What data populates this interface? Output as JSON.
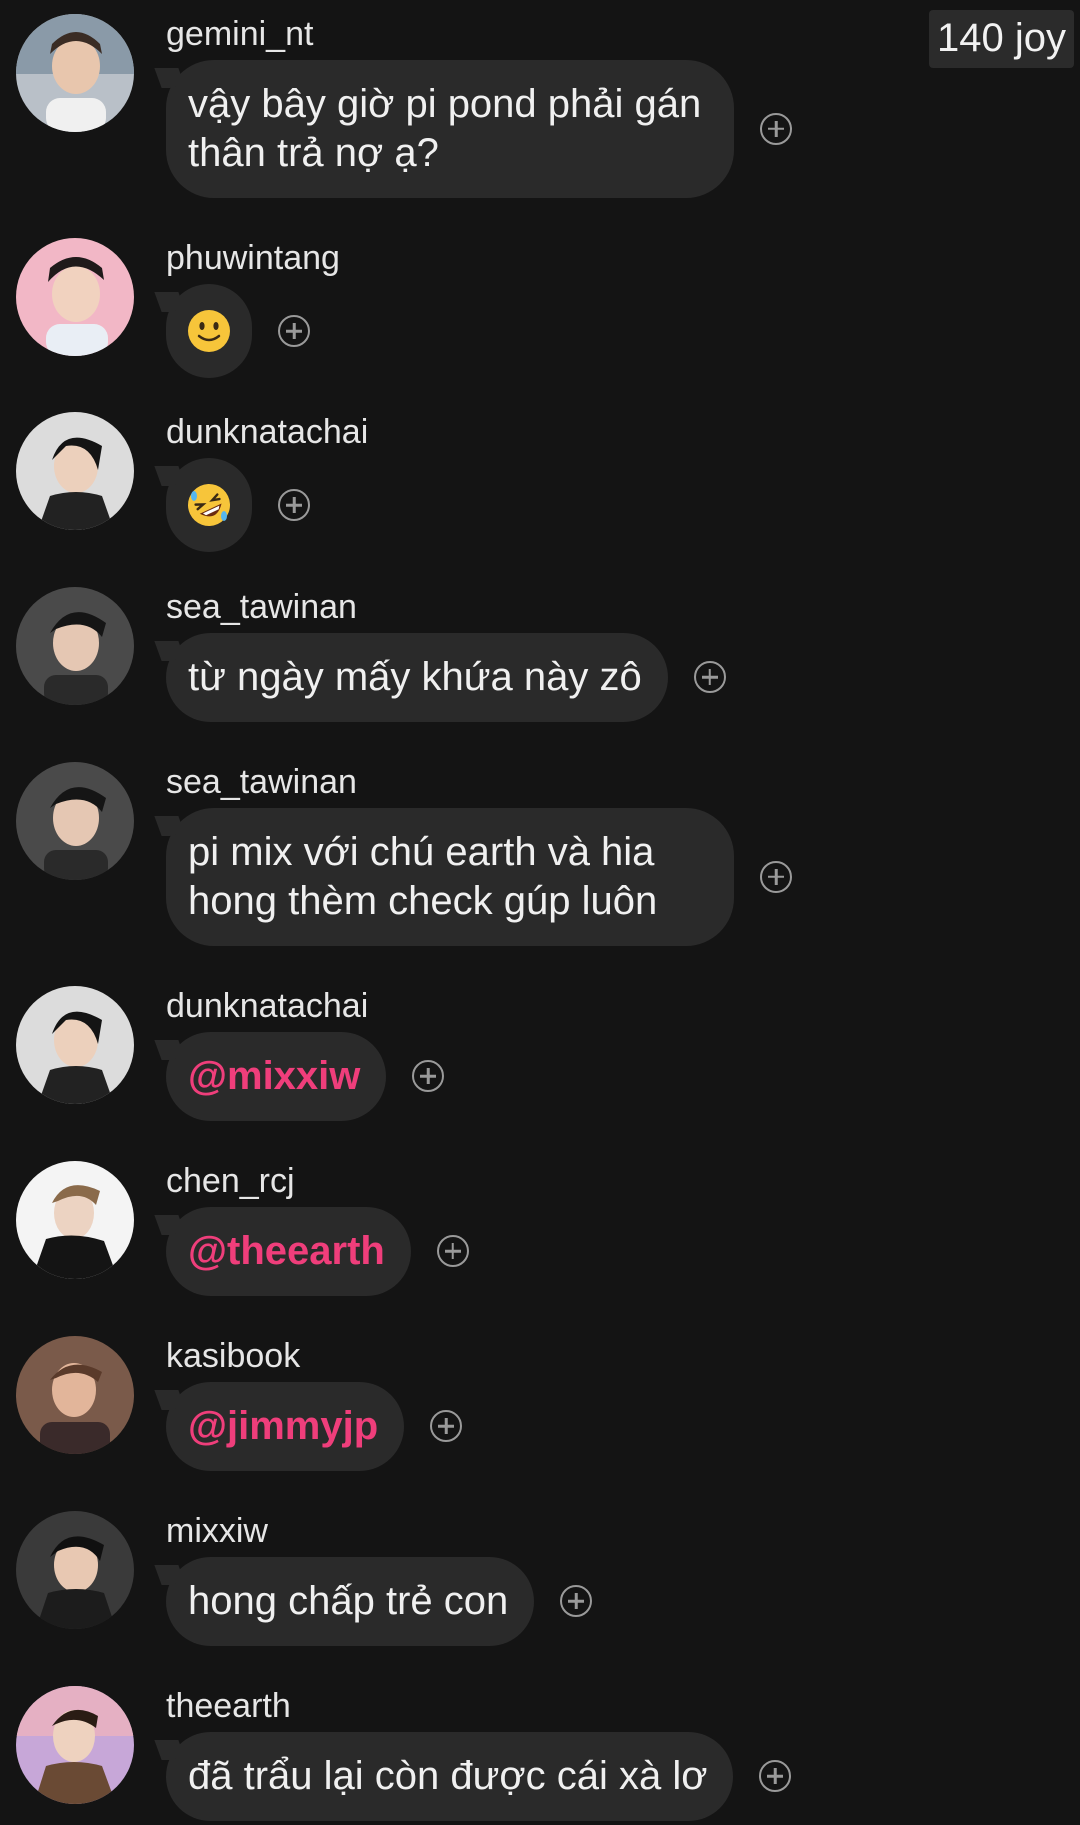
{
  "badge": {
    "label": "140 joy"
  },
  "messages": [
    {
      "username": "gemini_nt",
      "text": "vậy bây giờ pi pond phải gán thân trả nợ ạ?",
      "kind": "text"
    },
    {
      "username": "phuwintang",
      "emoji": "slightly-smiling-face",
      "kind": "emoji"
    },
    {
      "username": "dunknatachai",
      "emoji": "rolling-on-floor-laughing",
      "kind": "emoji"
    },
    {
      "username": "sea_tawinan",
      "text": "từ ngày mấy khứa này zô",
      "kind": "text"
    },
    {
      "username": "sea_tawinan",
      "text": "pi mix với chú earth và hia hong thèm check gúp luôn",
      "kind": "text"
    },
    {
      "username": "dunknatachai",
      "mention": "@mixxiw",
      "kind": "mention"
    },
    {
      "username": "chen_rcj",
      "mention": "@theearth",
      "kind": "mention"
    },
    {
      "username": "kasibook",
      "mention": "@jimmyjp",
      "kind": "mention"
    },
    {
      "username": "mixxiw",
      "text": "hong chấp trẻ con",
      "kind": "text"
    },
    {
      "username": "theearth",
      "text": "đã trẩu lại còn được cái xà lơ",
      "kind": "text"
    }
  ],
  "colors": {
    "background": "#141414",
    "bubble": "#2a2a2a",
    "mention": "#ef3e7b",
    "add_reaction_icon": "#9a9a9a"
  },
  "icons": {
    "add_reaction": "plus-circle-icon"
  }
}
